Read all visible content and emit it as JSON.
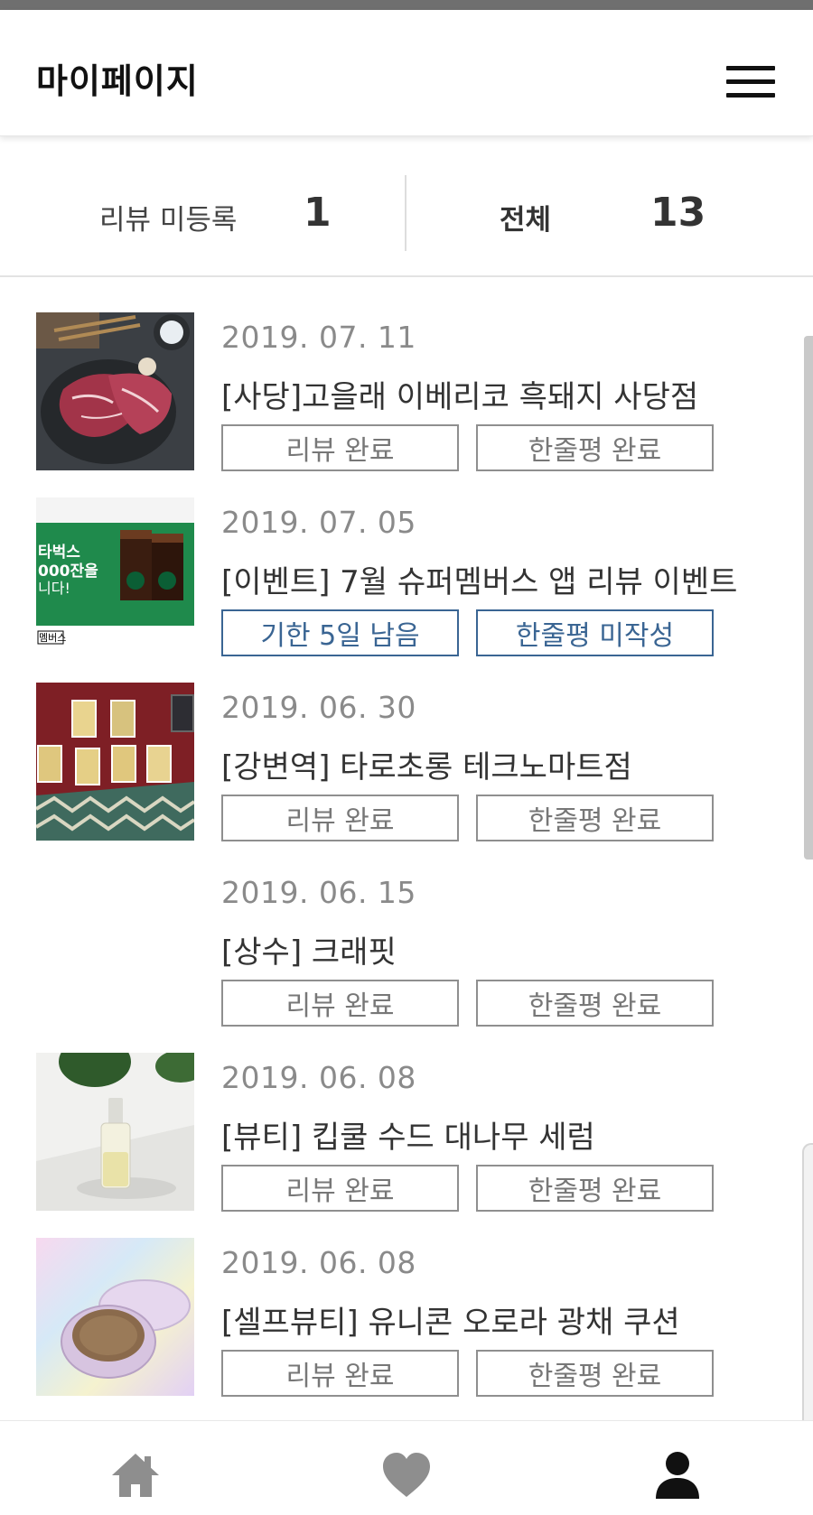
{
  "header": {
    "title": "마이페이지",
    "menu_icon": "hamburger-menu-icon"
  },
  "stats": {
    "unregistered_label": "리뷰 미등록",
    "unregistered_count": "1",
    "total_label": "전체",
    "total_count": "13"
  },
  "items": [
    {
      "date": "2019. 07. 11",
      "title": "[사당]고을래 이베리코 흑돼지 사당점",
      "left_button": "리뷰 완료",
      "right_button": "한줄평 완료",
      "status": "done",
      "thumbnail": "grilled-pork-photo"
    },
    {
      "date": "2019. 07. 05",
      "title": "[이벤트] 7월 슈퍼멤버스 앱 리뷰 이벤트",
      "left_button": "기한 5일 남음",
      "right_button": "한줄평 미작성",
      "status": "pending",
      "thumbnail": "starbucks-coffee-banner",
      "thumb_text": [
        "타벅스",
        "000잔을",
        "니다!",
        "멤버스"
      ]
    },
    {
      "date": "2019. 06. 30",
      "title": "[강변역] 타로초롱 테크노마트점",
      "left_button": "리뷰 완료",
      "right_button": "한줄평 완료",
      "status": "done",
      "thumbnail": "tarot-cards-photo"
    },
    {
      "date": "2019. 06. 15",
      "title": "[상수] 크래핏",
      "left_button": "리뷰 완료",
      "right_button": "한줄평 완료",
      "status": "done",
      "thumbnail": "blank"
    },
    {
      "date": "2019. 06. 08",
      "title": "[뷰티] 킵쿨 수드 대나무 세럼",
      "left_button": "리뷰 완료",
      "right_button": "한줄평 완료",
      "status": "done",
      "thumbnail": "serum-bottle-photo"
    },
    {
      "date": "2019. 06. 08",
      "title": "[셀프뷰티] 유니콘 오로라 광채 쿠션",
      "left_button": "리뷰 완료",
      "right_button": "한줄평 완료",
      "status": "done",
      "thumbnail": "cushion-compact-photo"
    }
  ],
  "bottom_nav": {
    "home_icon": "home-icon",
    "heart_icon": "heart-icon",
    "user_icon": "user-icon"
  },
  "colors": {
    "accent": "#3a6593",
    "border": "#8f8f8f",
    "date_text": "#8a8a8a"
  }
}
